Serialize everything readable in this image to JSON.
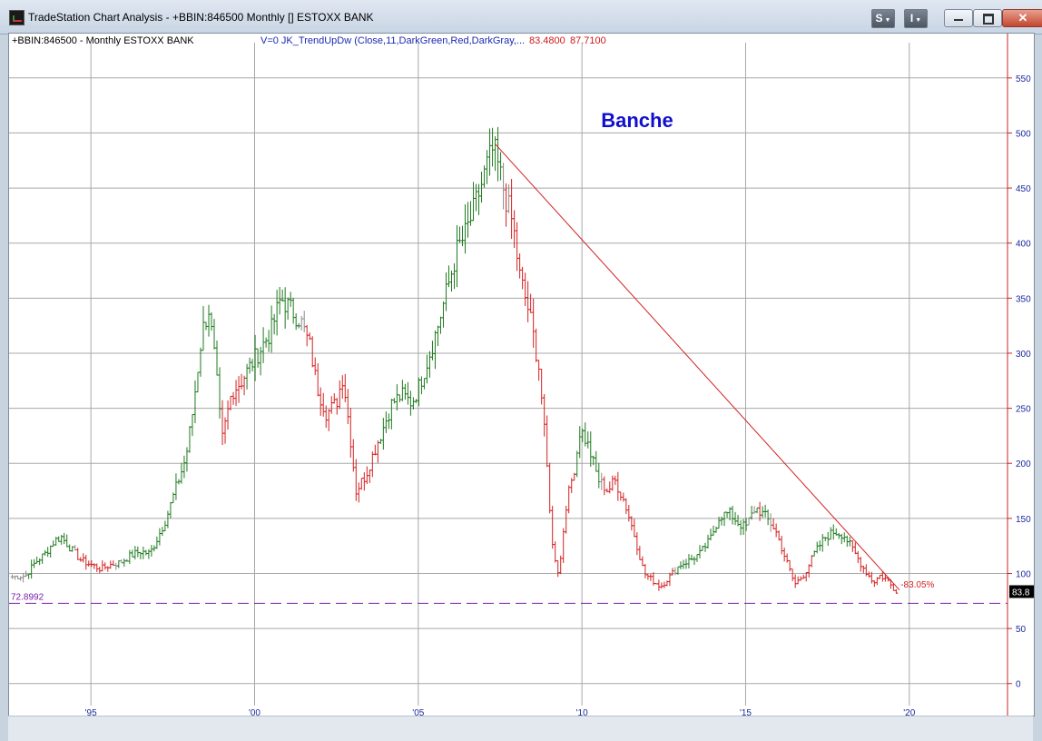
{
  "window": {
    "title": "TradeStation Chart Analysis - +BBIN:846500 Monthly [] ESTOXX BANK",
    "buttons": [
      "S",
      "I"
    ]
  },
  "chart_header": {
    "symbol_label": "+BBIN:846500 - Monthly  ESTOXX BANK",
    "indicator_label": "V=0  JK_TrendUpDw  (Close,11,DarkGreen,Red,DarkGray,...",
    "value1": "83.4800",
    "value2": "87.7100"
  },
  "colors": {
    "up": "#1e7a1e",
    "down": "#d42020",
    "neutral": "#8a8a8a",
    "axis": "#cc2222",
    "tick_text": "#1a2a9a",
    "support": "#7a1fa8",
    "title": "#1010cc"
  },
  "chart_data": {
    "type": "bar",
    "title": "Banche",
    "x_ticks": [
      "'95",
      "'00",
      "'05",
      "'10",
      "'15",
      "'20"
    ],
    "x_tick_years": [
      1995,
      2000,
      2005,
      2010,
      2015,
      2020
    ],
    "xlim": [
      1992.5,
      2023.0
    ],
    "y_ticks": [
      "0",
      "50",
      "100",
      "150",
      "200",
      "250",
      "300",
      "350",
      "400",
      "450",
      "500",
      "550"
    ],
    "ylim": [
      -20,
      582
    ],
    "grid": true,
    "series": [
      {
        "points": [
          [
            1992.6,
            97
          ],
          [
            1993.0,
            98
          ],
          [
            1993.3,
            110
          ],
          [
            1993.6,
            118
          ],
          [
            1993.9,
            130
          ],
          [
            1994.1,
            133
          ],
          [
            1994.4,
            122
          ],
          [
            1994.7,
            112
          ],
          [
            1995.0,
            108
          ],
          [
            1995.3,
            104
          ],
          [
            1995.6,
            108
          ],
          [
            1995.9,
            110
          ],
          [
            1996.2,
            116
          ],
          [
            1996.5,
            120
          ],
          [
            1996.8,
            118
          ],
          [
            1997.0,
            130
          ],
          [
            1997.3,
            150
          ],
          [
            1997.6,
            178
          ],
          [
            1997.9,
            205
          ],
          [
            1998.1,
            245
          ],
          [
            1998.4,
            320
          ],
          [
            1998.6,
            340
          ],
          [
            1998.8,
            290
          ],
          [
            1999.0,
            220
          ],
          [
            1999.3,
            265
          ],
          [
            1999.6,
            275
          ],
          [
            1999.9,
            290
          ],
          [
            2000.2,
            305
          ],
          [
            2000.5,
            320
          ],
          [
            2000.8,
            350
          ],
          [
            2001.1,
            340
          ],
          [
            2001.4,
            330
          ],
          [
            2001.7,
            305
          ],
          [
            2001.9,
            270
          ],
          [
            2002.2,
            245
          ],
          [
            2002.5,
            255
          ],
          [
            2002.7,
            280
          ],
          [
            2002.9,
            230
          ],
          [
            2003.1,
            175
          ],
          [
            2003.4,
            190
          ],
          [
            2003.7,
            215
          ],
          [
            2003.9,
            230
          ],
          [
            2004.2,
            255
          ],
          [
            2004.5,
            262
          ],
          [
            2004.8,
            255
          ],
          [
            2005.0,
            268
          ],
          [
            2005.3,
            295
          ],
          [
            2005.6,
            325
          ],
          [
            2005.9,
            360
          ],
          [
            2006.2,
            395
          ],
          [
            2006.4,
            405
          ],
          [
            2006.7,
            430
          ],
          [
            2006.9,
            450
          ],
          [
            2007.1,
            470
          ],
          [
            2007.3,
            486
          ],
          [
            2007.6,
            450
          ],
          [
            2007.9,
            415
          ],
          [
            2008.1,
            370
          ],
          [
            2008.4,
            335
          ],
          [
            2008.7,
            285
          ],
          [
            2008.9,
            210
          ],
          [
            2009.1,
            125
          ],
          [
            2009.3,
            98
          ],
          [
            2009.5,
            160
          ],
          [
            2009.8,
            200
          ],
          [
            2009.95,
            232
          ],
          [
            2010.2,
            215
          ],
          [
            2010.5,
            185
          ],
          [
            2010.8,
            175
          ],
          [
            2011.0,
            185
          ],
          [
            2011.3,
            165
          ],
          [
            2011.6,
            135
          ],
          [
            2011.9,
            100
          ],
          [
            2012.1,
            95
          ],
          [
            2012.4,
            88
          ],
          [
            2012.7,
            98
          ],
          [
            2013.0,
            108
          ],
          [
            2013.3,
            112
          ],
          [
            2013.6,
            118
          ],
          [
            2013.9,
            130
          ],
          [
            2014.2,
            152
          ],
          [
            2014.5,
            155
          ],
          [
            2014.8,
            145
          ],
          [
            2015.0,
            142
          ],
          [
            2015.3,
            160
          ],
          [
            2015.6,
            152
          ],
          [
            2015.9,
            140
          ],
          [
            2016.2,
            115
          ],
          [
            2016.5,
            90
          ],
          [
            2016.8,
            100
          ],
          [
            2017.1,
            118
          ],
          [
            2017.4,
            132
          ],
          [
            2017.7,
            138
          ],
          [
            2018.0,
            135
          ],
          [
            2018.3,
            120
          ],
          [
            2018.6,
            105
          ],
          [
            2018.9,
            92
          ],
          [
            2019.1,
            98
          ],
          [
            2019.3,
            95
          ],
          [
            2019.5,
            87
          ],
          [
            2019.65,
            83.5
          ]
        ]
      }
    ],
    "trendline": {
      "from": [
        2007.35,
        490
      ],
      "to": [
        2019.7,
        85
      ]
    },
    "support": {
      "value": "72.8992",
      "level": 72.9
    },
    "annotations": {
      "percent": "-83.05%",
      "last_value": "83.8"
    }
  }
}
